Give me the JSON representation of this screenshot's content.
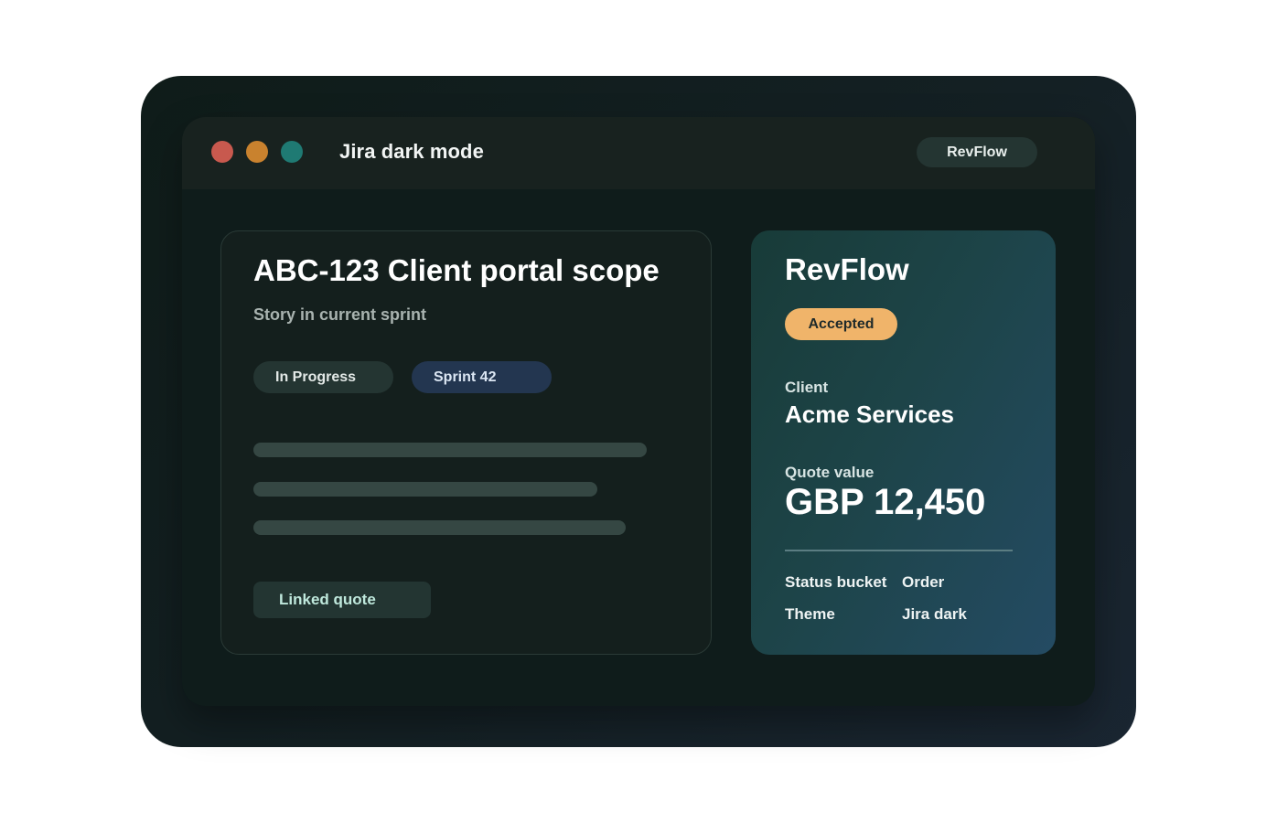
{
  "window": {
    "title": "Jira dark mode",
    "app_button": "RevFlow",
    "controls": {
      "close_color": "#c8594e",
      "minimize_color": "#c9822e",
      "maximize_color": "#1f7a73"
    }
  },
  "issue": {
    "title": "ABC-123 Client portal scope",
    "subtitle": "Story in current sprint",
    "tags": [
      {
        "label": "In Progress"
      },
      {
        "label": "Sprint 42"
      }
    ],
    "linked_button": "Linked quote"
  },
  "revflow": {
    "title": "RevFlow",
    "status": "Accepted",
    "client_label": "Client",
    "client_value": "Acme Services",
    "quote_label": "Quote value",
    "quote_value": "GBP 12,450",
    "meta": [
      {
        "key": "Status bucket",
        "value": "Order"
      },
      {
        "key": "Theme",
        "value": "Jira dark"
      }
    ]
  }
}
